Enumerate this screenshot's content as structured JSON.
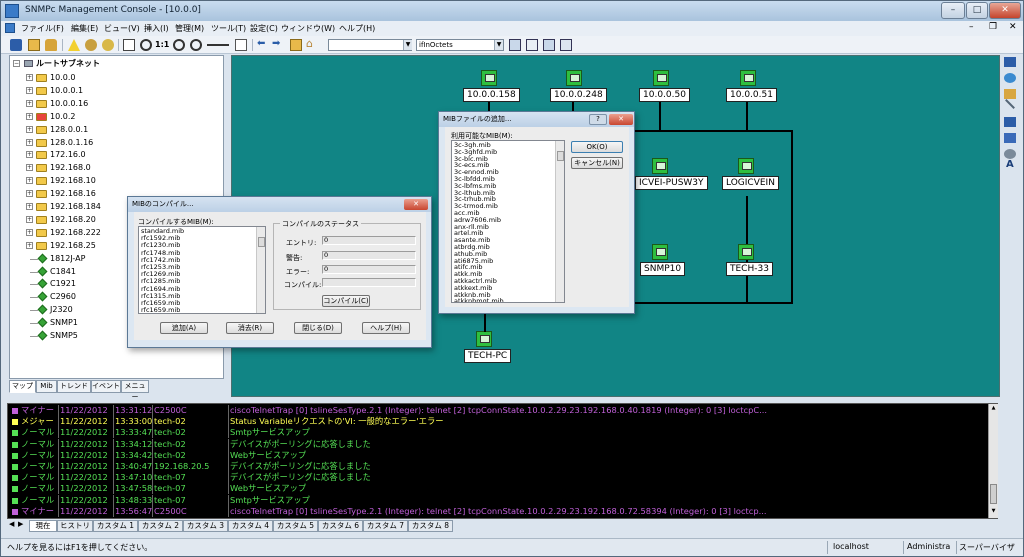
{
  "window": {
    "title": "SNMPc Management Console - [10.0.0]",
    "controls": {
      "minimize": "–",
      "maximize": "□",
      "close": "✕"
    }
  },
  "menubar": [
    "ファイル(F)",
    "編集(E)",
    "ビュー(V)",
    "挿入(I)",
    "管理(M)",
    "ツール(T)",
    "設定(C)",
    "ウィンドウ(W)",
    "ヘルプ(H)"
  ],
  "toolbar": {
    "zoom_label": "1:1",
    "combo1_value": "",
    "combo2_value": "ifInOctets"
  },
  "tree": {
    "root": "ルートサブネット",
    "subnets": [
      {
        "label": "10.0.0",
        "color": "#f2c94a"
      },
      {
        "label": "10.0.0.1",
        "color": "#f2c94a"
      },
      {
        "label": "10.0.0.16",
        "color": "#f2c94a"
      },
      {
        "label": "10.0.2",
        "color": "#e8453c"
      },
      {
        "label": "128.0.0.1",
        "color": "#f2c94a"
      },
      {
        "label": "128.0.1.16",
        "color": "#f2c94a"
      },
      {
        "label": "172.16.0",
        "color": "#f2c94a"
      },
      {
        "label": "192.168.0",
        "color": "#f2c94a"
      },
      {
        "label": "192.168.10",
        "color": "#f2c94a"
      },
      {
        "label": "192.168.16",
        "color": "#f2c94a"
      },
      {
        "label": "192.168.184",
        "color": "#f2c94a"
      },
      {
        "label": "192.168.20",
        "color": "#f2c94a"
      },
      {
        "label": "192.168.222",
        "color": "#f2c94a"
      },
      {
        "label": "192.168.25",
        "color": "#f2c94a"
      }
    ],
    "devices": [
      "1812J-AP",
      "C1841",
      "C1921",
      "C2960",
      "J2320",
      "SNMP1",
      "SNMP5"
    ]
  },
  "left_tabs": [
    "マップ",
    "Mib",
    "トレンド",
    "イベント",
    "メニュー"
  ],
  "map": {
    "nodes": [
      {
        "label": "10.0.0.158"
      },
      {
        "label": "10.0.0.248"
      },
      {
        "label": "10.0.0.50"
      },
      {
        "label": "10.0.0.51"
      },
      {
        "label": "ICVEI-PUSW3Y"
      },
      {
        "label": "LOGICVEIN"
      },
      {
        "label": "SNMP10"
      },
      {
        "label": "TECH-33"
      },
      {
        "label": "TECH-PC"
      }
    ]
  },
  "compile_dialog": {
    "title": "MIBのコンパイル...",
    "list_label": "コンパイルするMIB(M):",
    "mibs": [
      "standard.mib",
      "rfc1592.mib",
      "rfc1230.mib",
      "rfc1748.mib",
      "rfc1742.mib",
      "rfc1253.mib",
      "rfc1269.mib",
      "rfc1285.mib",
      "rfc1694.mib",
      "rfc1315.mib",
      "rfc1659.mib",
      "rfc1659.mib"
    ],
    "status_group": "コンパイルのステータス",
    "entry_label": "エントリ:",
    "entry_value": "0",
    "warning_label": "警告:",
    "warning_value": "0",
    "error_label": "エラー:",
    "error_value": "0",
    "compile_label": "コンパイル:",
    "compile_value": "",
    "compile_button": "コンパイル(C)",
    "add_button": "追加(A)",
    "delete_button": "消去(R)",
    "close_button": "閉じる(D)",
    "help_button": "ヘルプ(H)"
  },
  "addmib_dialog": {
    "title": "MIBファイルの追加...",
    "list_label": "利用可能なMIB(M):",
    "mibs": [
      "3c-3gh.mib",
      "3c-3ghfd.mib",
      "3c-blc.mib",
      "3c-ecs.mib",
      "3c-ennod.mib",
      "3c-lbfdd.mib",
      "3c-lbfms.mib",
      "3c-lthub.mib",
      "3c-trhub.mib",
      "3c-trmod.mib",
      "acc.mib",
      "adrw7606.mib",
      "anx-rll.mib",
      "artel.mib",
      "asante.mib",
      "atbrdg.mib",
      "athub.mib",
      "ati6875.mib",
      "atifc.mib",
      "atkk.mib",
      "atkkactrl.mib",
      "atkkext.mib",
      "atkknb.mib",
      "atkknbmgt.mib"
    ],
    "ok_button": "OK(O)",
    "cancel_button": "キャンセル(N)",
    "help_q": "?",
    "close_x": "✕"
  },
  "log": {
    "colors": {
      "minor": "#c060d8",
      "major": "#ffff55",
      "normal": "#55e055"
    },
    "rows": [
      {
        "sev": "マイナー",
        "date": "11/22/2012",
        "time": "13:31:12",
        "src": "C2500C",
        "msg": "ciscoTelnetTrap [0] tslineSesType.2.1 (Integer): telnet [2] tcpConnState.10.0.2.29.23.192.168.0.40.1819 (Integer): 0 [3] loctcpC...",
        "level": "minor"
      },
      {
        "sev": "メジャー",
        "date": "11/22/2012",
        "time": "13:33:00",
        "src": "tech-02",
        "msg": "Status Variableリクエストの'VI: 一般的なエラー'エラー",
        "level": "major"
      },
      {
        "sev": "ノーマル",
        "date": "11/22/2012",
        "time": "13:33:47",
        "src": "tech-02",
        "msg": "Smtpサービスアップ",
        "level": "normal"
      },
      {
        "sev": "ノーマル",
        "date": "11/22/2012",
        "time": "13:34:12",
        "src": "tech-02",
        "msg": "デバイスがポーリングに応答しました",
        "level": "normal"
      },
      {
        "sev": "ノーマル",
        "date": "11/22/2012",
        "time": "13:34:42",
        "src": "tech-02",
        "msg": "Webサービスアップ",
        "level": "normal"
      },
      {
        "sev": "ノーマル",
        "date": "11/22/2012",
        "time": "13:40:47",
        "src": "192.168.20.5",
        "msg": "デバイスがポーリングに応答しました",
        "level": "normal"
      },
      {
        "sev": "ノーマル",
        "date": "11/22/2012",
        "time": "13:47:10",
        "src": "tech-07",
        "msg": "デバイスがポーリングに応答しました",
        "level": "normal"
      },
      {
        "sev": "ノーマル",
        "date": "11/22/2012",
        "time": "13:47:58",
        "src": "tech-07",
        "msg": "Webサービスアップ",
        "level": "normal"
      },
      {
        "sev": "ノーマル",
        "date": "11/22/2012",
        "time": "13:48:33",
        "src": "tech-07",
        "msg": "Smtpサービスアップ",
        "level": "normal"
      },
      {
        "sev": "マイナー",
        "date": "11/22/2012",
        "time": "13:56:47",
        "src": "C2500C",
        "msg": "ciscoTelnetTrap [0] tslineSesType.2.1 (Integer): telnet [2] tcpConnState.10.0.2.29.23.192.168.0.72.58394 (Integer): 0 [3] loctcp...",
        "level": "minor"
      }
    ]
  },
  "bottom_tabs": [
    "現在",
    "ヒストリ",
    "カスタム 1",
    "カスタム 2",
    "カスタム 3",
    "カスタム 4",
    "カスタム 5",
    "カスタム 6",
    "カスタム 7",
    "カスタム 8"
  ],
  "status": {
    "help": "ヘルプを見るにはF1を押してください。",
    "host": "localhost",
    "user": "Administra",
    "role": "スーパーバイザ"
  }
}
